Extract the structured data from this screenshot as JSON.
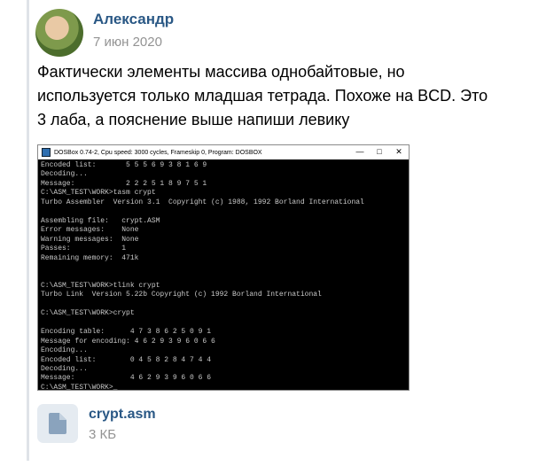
{
  "post": {
    "author": "Александр",
    "date": "7 июн 2020",
    "text": "Фактически элементы массива однобайтовые, но\nиспользуется только младшая тетрада. Похоже на BCD. Это\n3 лаба, а пояснение выше напиши левику"
  },
  "dosbox": {
    "title": "DOSBox 0.74-2, Cpu speed:   3000 cycles, Frameskip  0, Program:  DOSBOX",
    "console_lines": [
      "Encoded list:       5 5 5 6 9 3 8 1 6 9",
      "Decoding...",
      "Message:            2 2 2 5 1 8 9 7 5 1",
      "C:\\ASM_TEST\\WORK>tasm crypt",
      "Turbo Assembler  Version 3.1  Copyright (c) 1988, 1992 Borland International",
      "",
      "Assembling file:   crypt.ASM",
      "Error messages:    None",
      "Warning messages:  None",
      "Passes:            1",
      "Remaining memory:  471k",
      "",
      "",
      "C:\\ASM_TEST\\WORK>tlink crypt",
      "Turbo Link  Version 5.22b Copyright (c) 1992 Borland International",
      "",
      "C:\\ASM_TEST\\WORK>crypt",
      "",
      "Encoding table:      4 7 3 8 6 2 5 0 9 1",
      "Message for encoding: 4 6 2 9 3 9 6 0 6 6",
      "Encoding...",
      "Encoded list:        0 4 5 8 2 8 4 7 4 4",
      "Decoding...",
      "Message:             4 6 2 9 3 9 6 0 6 6",
      "C:\\ASM_TEST\\WORK>_"
    ]
  },
  "attachment": {
    "name": "crypt.asm",
    "size": "3 КБ"
  }
}
